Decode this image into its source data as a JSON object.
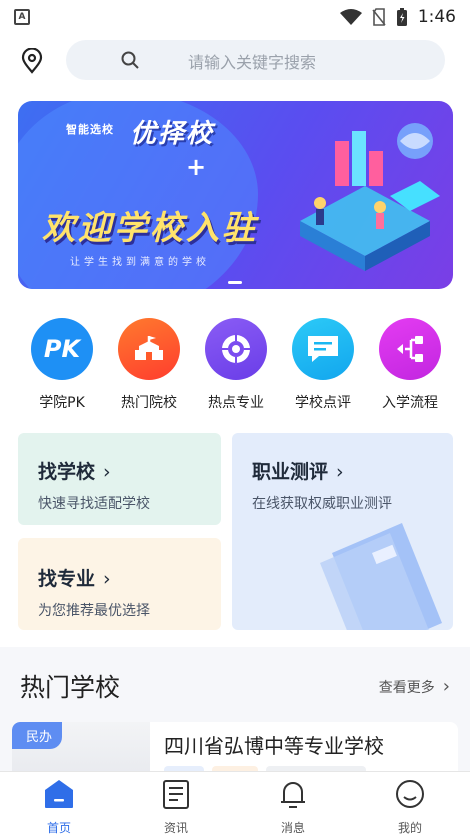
{
  "status_bar": {
    "time": "1:46",
    "app_badge": "A"
  },
  "search": {
    "placeholder": "请输入关键字搜索"
  },
  "banner": {
    "small_tag": "智能选校",
    "headline": "优择校",
    "plus": "+",
    "main_text": "欢迎学校入驻",
    "subtitle": "让学生找到满意的学校"
  },
  "quick_entries": [
    {
      "label": "学院PK",
      "icon": "pk-icon",
      "color": "#1e90f5",
      "glyph": "PK"
    },
    {
      "label": "热门院校",
      "icon": "campus-building-icon",
      "color": "#ff5a2a",
      "glyph": ""
    },
    {
      "label": "热点专业",
      "icon": "target-icon",
      "color": "#7b4cf0",
      "glyph": ""
    },
    {
      "label": "学校点评",
      "icon": "comment-icon",
      "color": "#19b7f2",
      "glyph": ""
    },
    {
      "label": "入学流程",
      "icon": "flow-icon",
      "color": "#d12fe8",
      "glyph": ""
    }
  ],
  "cards": {
    "find_school": {
      "title": "找学校",
      "subtitle": "快速寻找适配学校",
      "bg": "#e3f3ee"
    },
    "find_major": {
      "title": "找专业",
      "subtitle": "为您推荐最优选择",
      "bg": "#fdf4e6"
    },
    "career_test": {
      "title": "职业测评",
      "subtitle": "在线获取权威职业测评",
      "bg": "#e3ecfb"
    }
  },
  "hot_schools": {
    "title": "热门学校",
    "more": "查看更多",
    "items": [
      {
        "badge": "民办",
        "name": "四川省弘博中等专业学校"
      }
    ]
  },
  "tabbar": [
    {
      "label": "首页",
      "icon": "home-icon",
      "active": true
    },
    {
      "label": "资讯",
      "icon": "news-icon",
      "active": false
    },
    {
      "label": "消息",
      "icon": "bell-icon",
      "active": false
    },
    {
      "label": "我的",
      "icon": "profile-icon",
      "active": false
    }
  ],
  "colors": {
    "accent": "#2f6ee8",
    "banner_yellow": "#ffe36b"
  }
}
